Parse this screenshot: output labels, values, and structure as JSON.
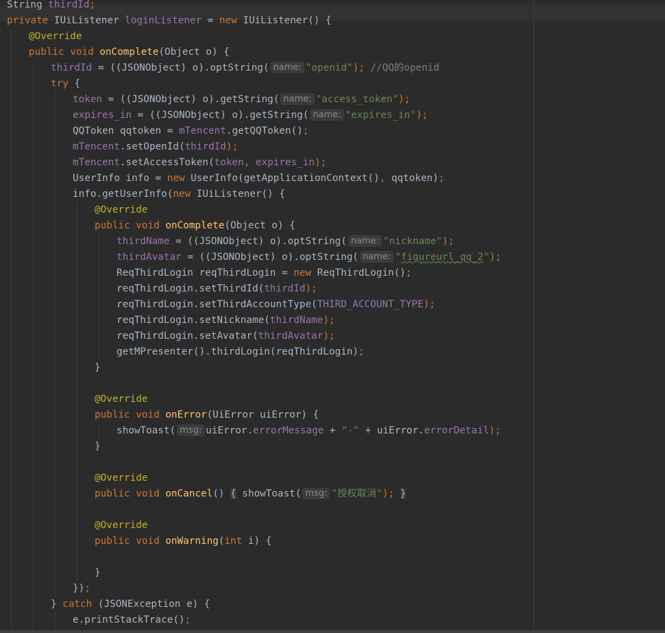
{
  "colors": {
    "background": "#2b2b2b",
    "current_line": "#323232",
    "keyword": "#cc7832",
    "annotation": "#bbb529",
    "field": "#9876aa",
    "string": "#6a8759",
    "method_declaration": "#ffc66d",
    "comment": "#808080",
    "plain": "#a9b7c6",
    "parameter_hint": "#8c8c8c"
  },
  "editor": {
    "language": "Java",
    "lines": [
      {
        "indent": 0,
        "tokens": [
          [
            "String ",
            "tk-plain"
          ],
          [
            "thirdId",
            "tk-fld"
          ],
          [
            ";",
            "tk-punc"
          ]
        ]
      },
      {
        "indent": 0,
        "tokens": [
          [
            "private ",
            "tk-kw"
          ],
          [
            "IUiListener ",
            "tk-plain"
          ],
          [
            "loginListener",
            "tk-fld"
          ],
          [
            " = ",
            "tk-plain"
          ],
          [
            "new ",
            "tk-kw"
          ],
          [
            "IUiListener() {",
            "tk-plain"
          ]
        ]
      },
      {
        "indent": 1,
        "tokens": [
          [
            "@Override",
            "tk-ann"
          ]
        ]
      },
      {
        "indent": 1,
        "tokens": [
          [
            "public ",
            "tk-kw"
          ],
          [
            "void ",
            "tk-kw"
          ],
          [
            "onComplete",
            "tk-fn"
          ],
          [
            "(Object o) {",
            "tk-plain"
          ]
        ]
      },
      {
        "indent": 2,
        "tokens": [
          [
            "thirdId",
            "tk-fld"
          ],
          [
            " = ((JSONObject) o).optString(",
            "tk-plain"
          ],
          [
            "name:",
            "tk-hint"
          ],
          [
            "\"openid\"",
            "tk-str"
          ],
          [
            ");",
            "tk-punc"
          ],
          [
            " //QQ的openid",
            "tk-cm"
          ]
        ]
      },
      {
        "indent": 2,
        "tokens": [
          [
            "try ",
            "tk-kw"
          ],
          [
            "{",
            "tk-plain"
          ]
        ]
      },
      {
        "indent": 3,
        "tokens": [
          [
            "token",
            "tk-fld"
          ],
          [
            " = ((JSONObject) o).getString(",
            "tk-plain"
          ],
          [
            "name:",
            "tk-hint"
          ],
          [
            "\"access_token\"",
            "tk-str"
          ],
          [
            ");",
            "tk-punc"
          ]
        ]
      },
      {
        "indent": 3,
        "tokens": [
          [
            "expires_in",
            "tk-fld"
          ],
          [
            " = ((JSONObject) o).getString(",
            "tk-plain"
          ],
          [
            "name:",
            "tk-hint"
          ],
          [
            "\"expires_in\"",
            "tk-str"
          ],
          [
            ");",
            "tk-punc"
          ]
        ]
      },
      {
        "indent": 3,
        "tokens": [
          [
            "QQToken qqtoken = ",
            "tk-plain"
          ],
          [
            "mTencent",
            "tk-fld"
          ],
          [
            ".getQQToken()",
            "tk-plain"
          ],
          [
            ";",
            "tk-punc"
          ]
        ]
      },
      {
        "indent": 3,
        "tokens": [
          [
            "mTencent",
            "tk-fld"
          ],
          [
            ".setOpenId(",
            "tk-plain"
          ],
          [
            "thirdId",
            "tk-fld"
          ],
          [
            ");",
            "tk-punc"
          ]
        ]
      },
      {
        "indent": 3,
        "tokens": [
          [
            "mTencent",
            "tk-fld"
          ],
          [
            ".setAccessToken(",
            "tk-plain"
          ],
          [
            "token",
            "tk-fld"
          ],
          [
            ", ",
            "tk-punc"
          ],
          [
            "expires_in",
            "tk-fld"
          ],
          [
            ");",
            "tk-punc"
          ]
        ]
      },
      {
        "indent": 3,
        "tokens": [
          [
            "UserInfo info = ",
            "tk-plain"
          ],
          [
            "new ",
            "tk-kw"
          ],
          [
            "UserInfo(getApplicationContext()",
            "tk-plain"
          ],
          [
            ", ",
            "tk-punc"
          ],
          [
            "qqtoken)",
            "tk-plain"
          ],
          [
            ";",
            "tk-punc"
          ]
        ]
      },
      {
        "indent": 3,
        "tokens": [
          [
            "info.getUserInfo(",
            "tk-plain"
          ],
          [
            "new ",
            "tk-kw"
          ],
          [
            "IUiListener() {",
            "tk-plain"
          ]
        ]
      },
      {
        "indent": 4,
        "tokens": [
          [
            "@Override",
            "tk-ann"
          ]
        ]
      },
      {
        "indent": 4,
        "tokens": [
          [
            "public ",
            "tk-kw"
          ],
          [
            "void ",
            "tk-kw"
          ],
          [
            "onComplete",
            "tk-fn"
          ],
          [
            "(Object o) {",
            "tk-plain"
          ]
        ]
      },
      {
        "indent": 5,
        "tokens": [
          [
            "thirdName",
            "tk-fld"
          ],
          [
            " = ((JSONObject) o).optString(",
            "tk-plain"
          ],
          [
            "name:",
            "tk-hint"
          ],
          [
            "\"nickname\"",
            "tk-str"
          ],
          [
            ");",
            "tk-punc"
          ]
        ]
      },
      {
        "indent": 5,
        "tokens": [
          [
            "thirdAvatar",
            "tk-fld"
          ],
          [
            " = ((JSONObject) o).optString(",
            "tk-plain"
          ],
          [
            "name:",
            "tk-hint"
          ],
          [
            "\"",
            "tk-str"
          ],
          [
            "figureurl_qq_2",
            "tk-str tk-squig"
          ],
          [
            "\"",
            "tk-str"
          ],
          [
            ");",
            "tk-punc"
          ]
        ]
      },
      {
        "indent": 5,
        "tokens": [
          [
            "ReqThirdLogin reqThirdLogin = ",
            "tk-plain"
          ],
          [
            "new ",
            "tk-kw"
          ],
          [
            "ReqThirdLogin()",
            "tk-plain"
          ],
          [
            ";",
            "tk-punc"
          ]
        ]
      },
      {
        "indent": 5,
        "tokens": [
          [
            "reqThirdLogin.setThirdId(",
            "tk-plain"
          ],
          [
            "thirdId",
            "tk-fld"
          ],
          [
            ");",
            "tk-punc"
          ]
        ]
      },
      {
        "indent": 5,
        "tokens": [
          [
            "reqThirdLogin.setThirdAccountType(",
            "tk-plain"
          ],
          [
            "THIRD_ACCOUNT_TYPE",
            "tk-fld"
          ],
          [
            ");",
            "tk-punc"
          ]
        ]
      },
      {
        "indent": 5,
        "tokens": [
          [
            "reqThirdLogin.setNickname(",
            "tk-plain"
          ],
          [
            "thirdName",
            "tk-fld"
          ],
          [
            ");",
            "tk-punc"
          ]
        ]
      },
      {
        "indent": 5,
        "tokens": [
          [
            "reqThirdLogin.setAvatar(",
            "tk-plain"
          ],
          [
            "thirdAvatar",
            "tk-fld"
          ],
          [
            ");",
            "tk-punc"
          ]
        ]
      },
      {
        "indent": 5,
        "tokens": [
          [
            "getMPresenter().thirdLogin(reqThirdLogin)",
            "tk-plain"
          ],
          [
            ";",
            "tk-punc"
          ]
        ]
      },
      {
        "indent": 4,
        "tokens": [
          [
            "}",
            "tk-plain"
          ]
        ]
      },
      {
        "indent": 0,
        "tokens": []
      },
      {
        "indent": 4,
        "tokens": [
          [
            "@Override",
            "tk-ann"
          ]
        ]
      },
      {
        "indent": 4,
        "tokens": [
          [
            "public ",
            "tk-kw"
          ],
          [
            "void ",
            "tk-kw"
          ],
          [
            "onError",
            "tk-fn"
          ],
          [
            "(UiError uiError) {",
            "tk-plain"
          ]
        ]
      },
      {
        "indent": 5,
        "tokens": [
          [
            "showToast(",
            "tk-plain"
          ],
          [
            "msg:",
            "tk-hint"
          ],
          [
            "uiError.",
            "tk-plain"
          ],
          [
            "errorMessage",
            "tk-fld"
          ],
          [
            " + ",
            "tk-plain"
          ],
          [
            "\"-\"",
            "tk-str"
          ],
          [
            " + uiError.",
            "tk-plain"
          ],
          [
            "errorDetail",
            "tk-fld"
          ],
          [
            ");",
            "tk-punc"
          ]
        ]
      },
      {
        "indent": 4,
        "tokens": [
          [
            "}",
            "tk-plain"
          ]
        ]
      },
      {
        "indent": 0,
        "tokens": []
      },
      {
        "indent": 4,
        "tokens": [
          [
            "@Override",
            "tk-ann"
          ]
        ]
      },
      {
        "indent": 4,
        "tokens": [
          [
            "public ",
            "tk-kw"
          ],
          [
            "void ",
            "tk-kw"
          ],
          [
            "onCancel",
            "tk-fn"
          ],
          [
            "() ",
            "tk-plain"
          ],
          [
            "{",
            "tk-plain tk-fold"
          ],
          [
            " showToast(",
            "tk-plain"
          ],
          [
            "msg:",
            "tk-hint"
          ],
          [
            "\"授权取消\"",
            "tk-str"
          ],
          [
            ");",
            "tk-punc"
          ],
          [
            " ",
            "tk-plain"
          ],
          [
            "}",
            "tk-plain tk-fold"
          ]
        ]
      },
      {
        "indent": 0,
        "tokens": []
      },
      {
        "indent": 4,
        "tokens": [
          [
            "@Override",
            "tk-ann"
          ]
        ]
      },
      {
        "indent": 4,
        "tokens": [
          [
            "public ",
            "tk-kw"
          ],
          [
            "void ",
            "tk-kw"
          ],
          [
            "onWarning",
            "tk-fn"
          ],
          [
            "(",
            "tk-plain"
          ],
          [
            "int ",
            "tk-kw"
          ],
          [
            "i) {",
            "tk-plain"
          ]
        ]
      },
      {
        "indent": 0,
        "tokens": []
      },
      {
        "indent": 4,
        "tokens": [
          [
            "}",
            "tk-plain"
          ]
        ]
      },
      {
        "indent": 3,
        "tokens": [
          [
            "})",
            "tk-plain"
          ],
          [
            ";",
            "tk-punc"
          ]
        ]
      },
      {
        "indent": 2,
        "tokens": [
          [
            "} ",
            "tk-plain"
          ],
          [
            "catch ",
            "tk-kw"
          ],
          [
            "(JSONException e) {",
            "tk-plain"
          ]
        ]
      },
      {
        "indent": 3,
        "tokens": [
          [
            "e.printStackTrace()",
            "tk-plain"
          ],
          [
            ";",
            "tk-punc"
          ]
        ]
      },
      {
        "indent": 2,
        "tokens": [
          [
            "}",
            "tk-plain"
          ]
        ]
      }
    ]
  }
}
